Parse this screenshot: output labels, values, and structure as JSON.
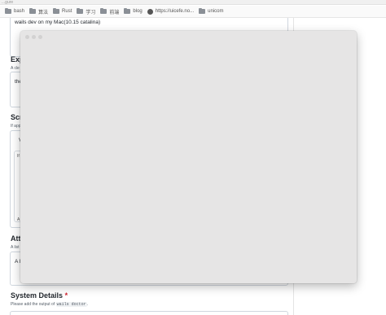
{
  "top_strip": {
    "text": "...gure"
  },
  "bookmarks": [
    {
      "label": "bash",
      "icon": "folder-icon"
    },
    {
      "label": "算法",
      "icon": "folder-icon"
    },
    {
      "label": "Rust",
      "icon": "folder-icon"
    },
    {
      "label": "学习",
      "icon": "folder-icon"
    },
    {
      "label": "前端",
      "icon": "folder-icon"
    },
    {
      "label": "blog",
      "icon": "folder-icon"
    },
    {
      "label": "https://uicefe.no...",
      "icon": "globe-icon"
    },
    {
      "label": "unicom",
      "icon": "folder-icon"
    }
  ],
  "form": {
    "steps_value": "wails dev on my Mac(10.15 catalina)",
    "expected_heading": "Exp",
    "expected_hint": "A cle",
    "expected_value": "the",
    "screenshots_heading": "Scr",
    "screenshots_hint": "If app",
    "screenshots_v": "V",
    "screenshots_if": "If",
    "screenshots_a": "A",
    "attempted_heading": "Att",
    "attempted_hint": "A list",
    "attempted_value": "A l",
    "system_heading": "System Details",
    "system_required": "*",
    "system_hint_prefix": "Please add the output of",
    "system_hint_code": "wails doctor",
    "system_hint_suffix": "."
  },
  "colors": {
    "overlay": "#e6e5e5",
    "required": "#cf222e"
  }
}
